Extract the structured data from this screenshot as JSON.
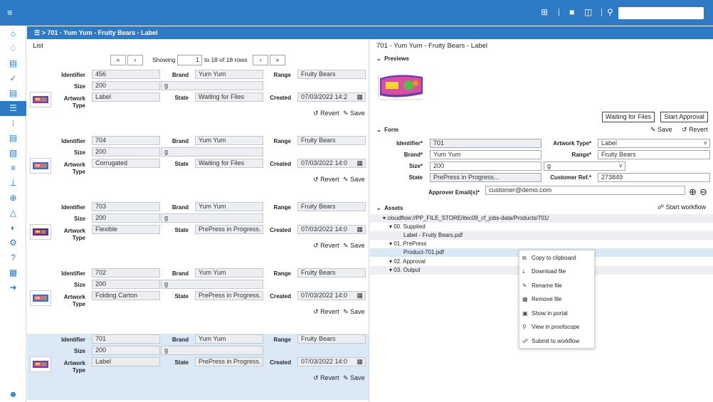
{
  "topbar": {
    "menu_icon": "hamburger-icon",
    "icons": [
      "add-box-icon",
      "stop-icon",
      "columns-icon",
      "search-icon"
    ],
    "search_value": ""
  },
  "sidebar": {
    "icons": [
      "home-icon",
      "bell-icon",
      "inbox-icon",
      "check-circle-icon",
      "clipboard-icon",
      "list-icon",
      "network-icon",
      "server-icon",
      "hierarchy-icon",
      "layers-icon",
      "branch-icon",
      "target-icon",
      "warning-icon",
      "gauge-icon",
      "settings-icon",
      "help-icon",
      "grid-icon",
      "arrow-right-icon"
    ],
    "bottom_icon": "user-icon"
  },
  "breadcrumb": {
    "separator": ">",
    "title": "701 - Yum Yum - Fruity Bears - Label"
  },
  "list": {
    "title": "List",
    "pager": {
      "first": "«",
      "prev": "‹",
      "label": "Showing",
      "value": "1",
      "range": "to 18 of 18 rows",
      "next": "›",
      "last": "»"
    },
    "labels": {
      "identifier": "Identifier",
      "brand": "Brand",
      "range": "Range",
      "size": "Size",
      "artwork": "Artwork",
      "type": "Type",
      "state": "State",
      "created": "Created",
      "revert": "Revert",
      "save": "Save"
    },
    "records": [
      {
        "identifier": "456",
        "brand": "Yum Yum",
        "range": "Fruity Bears",
        "size": "200",
        "unit": "g",
        "type": "Label",
        "state": "Waiting for Files",
        "created": "07/03/2022 14:2̣",
        "selected": false
      },
      {
        "identifier": "704",
        "brand": "Yum Yum",
        "range": "Fruity Bears",
        "size": "200",
        "unit": "g",
        "type": "Corrugated",
        "state": "Waiting for Files",
        "created": "07/03/2022 14:0",
        "selected": false
      },
      {
        "identifier": "703",
        "brand": "Yum Yum",
        "range": "Fruity Bears",
        "size": "200",
        "unit": "g",
        "type": "Flexible",
        "state": "PrePress in Progress.",
        "created": "07/03/2022 14:0",
        "selected": false
      },
      {
        "identifier": "702",
        "brand": "Yum Yum",
        "range": "Fruity Bears",
        "size": "200",
        "unit": "g",
        "type": "Folding Carton",
        "state": "PrePress in Progress.",
        "created": "07/03/2022 14:0",
        "selected": false
      },
      {
        "identifier": "701",
        "brand": "Yum Yum",
        "range": "Fruity Bears",
        "size": "200",
        "unit": "g",
        "type": "Label",
        "state": "PrePress in Progress.",
        "created": "07/03/2022 14:0",
        "selected": true
      }
    ]
  },
  "detail": {
    "title": "701 - Yum Yum - Fruity Bears - Label",
    "previews_label": "Previews",
    "state_button": "Waiting for Files",
    "start_approval": "Start Approval",
    "form_label": "Form",
    "save": "Save",
    "revert": "Revert",
    "form": {
      "identifier_label": "Identifier*",
      "identifier": "701",
      "artwork_type_label": "Artwork Type*",
      "artwork_type": "Label",
      "brand_label": "Brand*",
      "brand": "Yum Yum",
      "range_label": "Range*",
      "range": "Fruity Bears",
      "size_label": "Size*",
      "size": "200",
      "unit": "g",
      "state_label": "State",
      "state": "PrePress in Progress...",
      "customer_ref_label": "Customer Ref.*",
      "customer_ref": "273849",
      "approver_label": "Approver Email(s)*",
      "approver": "customer@demo.com"
    },
    "assets_label": "Assets",
    "start_workflow": "Start workflow",
    "tree": [
      {
        "text": "cloudflow://PP_FILE_STORE/itec09_cf_jobs-data/Products/701/"
      },
      {
        "text": "00. Supplied"
      },
      {
        "text": "Label - Fruity Bears.pdf"
      },
      {
        "text": "01. PrePress"
      },
      {
        "text": "Product-701.pdf"
      },
      {
        "text": "02. Approval"
      },
      {
        "text": "03. Output"
      }
    ]
  },
  "context_menu": [
    {
      "label": "Copy to clipboard",
      "icon": "copy-icon"
    },
    {
      "label": "Download file",
      "icon": "download-icon"
    },
    {
      "label": "Rename file",
      "icon": "pencil-icon"
    },
    {
      "label": "Remove file",
      "icon": "trash-icon"
    },
    {
      "label": "Show in portal",
      "icon": "folder-icon"
    },
    {
      "label": "View in proofscope",
      "icon": "magnifier-icon"
    },
    {
      "label": "Submit to workflow",
      "icon": "workflow-icon"
    }
  ]
}
